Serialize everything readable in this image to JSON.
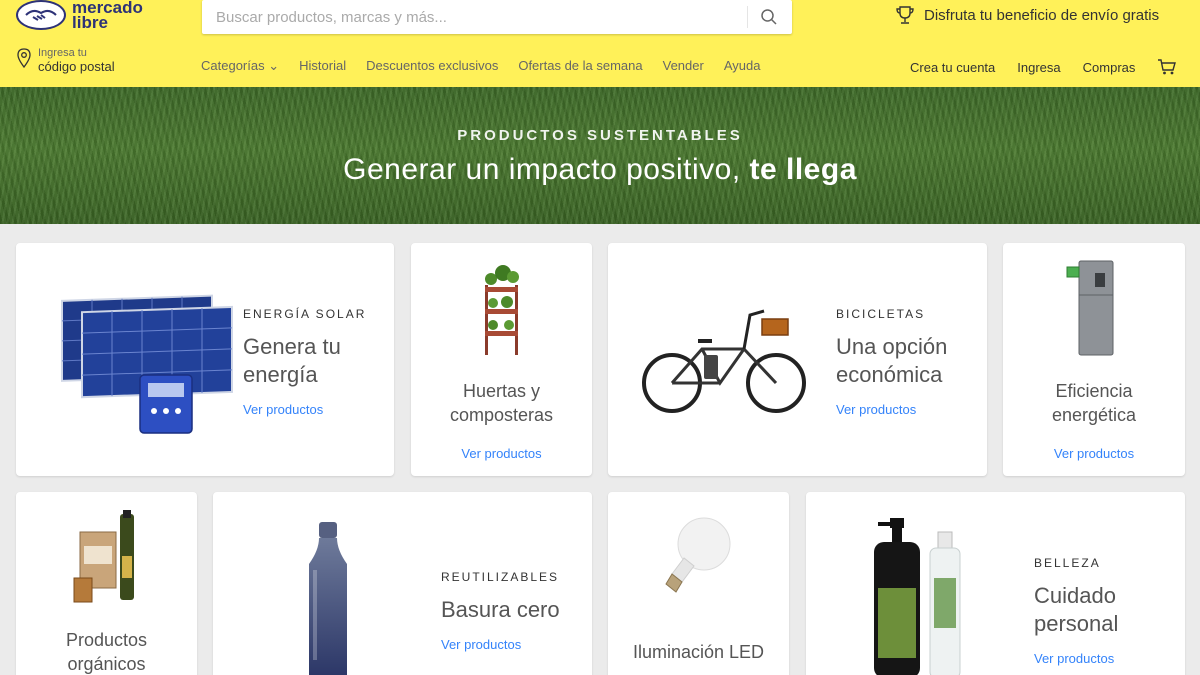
{
  "header": {
    "logo_line1": "mercado",
    "logo_line2": "libre",
    "search_placeholder": "Buscar productos, marcas y más...",
    "promo": "Disfruta tu beneficio de envío gratis",
    "postal_small": "Ingresa tu",
    "postal_big": "código postal",
    "nav": [
      "Categorías",
      "Historial",
      "Descuentos exclusivos",
      "Ofertas de la semana",
      "Vender",
      "Ayuda"
    ],
    "account": [
      "Crea tu cuenta",
      "Ingresa",
      "Compras"
    ]
  },
  "banner": {
    "eyebrow": "PRODUCTOS SUSTENTABLES",
    "title_regular": "Generar un impacto positivo,",
    "title_bold": "te llega"
  },
  "cards": {
    "solar": {
      "eyebrow": "ENERGÍA SOLAR",
      "line1": "Genera tu",
      "line2": "energía",
      "link": "Ver productos"
    },
    "huertas": {
      "line1": "Huertas y",
      "line2": "composteras",
      "link": "Ver productos"
    },
    "bicis": {
      "eyebrow": "BICICLETAS",
      "line1": "Una opción",
      "line2": "económica",
      "link": "Ver productos"
    },
    "eficiencia": {
      "line1": "Eficiencia",
      "line2": "energética",
      "link": "Ver productos"
    },
    "organicos": {
      "line1": "Productos",
      "line2": "orgánicos"
    },
    "reutilizables": {
      "eyebrow": "REUTILIZABLES",
      "title": "Basura cero",
      "link": "Ver productos"
    },
    "led": {
      "title": "Iluminación LED"
    },
    "belleza": {
      "eyebrow": "BELLEZA",
      "line1": "Cuidado",
      "line2": "personal",
      "link": "Ver productos"
    }
  },
  "colors": {
    "header": "#fff159",
    "link": "#3483fa",
    "background": "#ebebeb"
  }
}
